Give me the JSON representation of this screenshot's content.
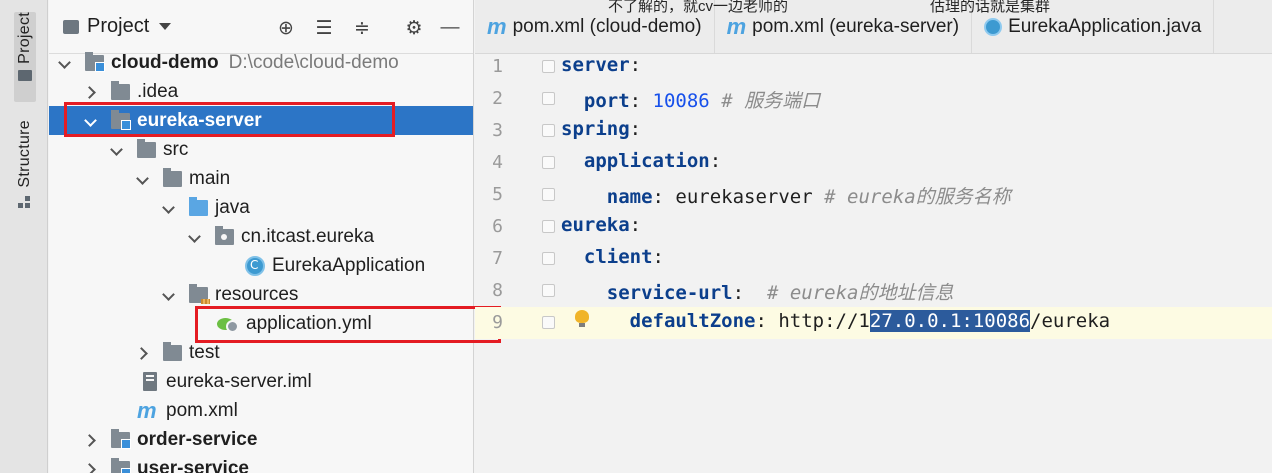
{
  "side_stripe": {
    "project_label": "Project",
    "structure_label": "Structure"
  },
  "project_panel": {
    "title": "Project",
    "toolbar_icons": [
      "locate-icon",
      "expand-all-icon",
      "collapse-all-icon",
      "gear-icon",
      "hide-icon"
    ],
    "tree": [
      {
        "label": "cloud-demo",
        "path": "D:\\code\\cloud-demo",
        "bold": true,
        "expanded": true,
        "icon": "module-folder-icon"
      },
      {
        "label": ".idea",
        "expanded": false,
        "icon": "folder-icon"
      },
      {
        "label": "eureka-server",
        "bold": true,
        "expanded": true,
        "selected": true,
        "icon": "module-folder-icon"
      },
      {
        "label": "src",
        "expanded": true,
        "icon": "folder-icon"
      },
      {
        "label": "main",
        "expanded": true,
        "icon": "folder-icon"
      },
      {
        "label": "java",
        "expanded": true,
        "icon": "source-folder-icon"
      },
      {
        "label": "cn.itcast.eureka",
        "expanded": true,
        "icon": "package-icon"
      },
      {
        "label": "EurekaApplication",
        "icon": "java-class-icon"
      },
      {
        "label": "resources",
        "expanded": true,
        "icon": "resources-folder-icon"
      },
      {
        "label": "application.yml",
        "icon": "yaml-file-icon"
      },
      {
        "label": "test",
        "expanded": false,
        "icon": "folder-icon"
      },
      {
        "label": "eureka-server.iml",
        "icon": "iml-file-icon"
      },
      {
        "label": "pom.xml",
        "icon": "maven-icon"
      },
      {
        "label": "order-service",
        "bold": true,
        "expanded": false,
        "icon": "module-folder-icon"
      },
      {
        "label": "user-service",
        "bold": true,
        "expanded": false,
        "icon": "module-folder-icon"
      }
    ]
  },
  "editor": {
    "tabs": [
      {
        "label": "pom.xml (cloud-demo)",
        "icon": "maven-icon"
      },
      {
        "label": "pom.xml (eureka-server)",
        "icon": "maven-icon"
      },
      {
        "label": "EurekaApplication.java",
        "icon": "java-class-icon"
      }
    ],
    "captions": [
      "不了解的，就cv一边老师的",
      "估理的话就是集群"
    ],
    "lines": [
      {
        "n": "1",
        "key": "server",
        "rest": ":"
      },
      {
        "n": "2",
        "indent": "  ",
        "key": "port",
        "rest": ": ",
        "value": "10086",
        "comment": " # 服务端口"
      },
      {
        "n": "3",
        "key": "spring",
        "rest": ":"
      },
      {
        "n": "4",
        "indent": "  ",
        "key": "application",
        "rest": ":"
      },
      {
        "n": "5",
        "indent": "    ",
        "key": "name",
        "rest": ": eurekaserver",
        "comment": " # eureka的服务名称"
      },
      {
        "n": "6",
        "key": "eureka",
        "rest": ":"
      },
      {
        "n": "7",
        "indent": "  ",
        "key": "client",
        "rest": ":"
      },
      {
        "n": "8",
        "indent": "    ",
        "key": "service-url",
        "rest": ":",
        "comment": "  # eureka的地址信息"
      },
      {
        "n": "9",
        "indent": "      ",
        "key": "defaultZone",
        "rest": ": http://1",
        "selected": "27.0.0.1:10086",
        "tail": "/eureka"
      }
    ]
  },
  "colors": {
    "selection": "#2c75c6",
    "highlight_box": "#e41c23",
    "yaml_key": "#0c3f8c",
    "number": "#1750eb",
    "comment": "#8c8c8c"
  }
}
